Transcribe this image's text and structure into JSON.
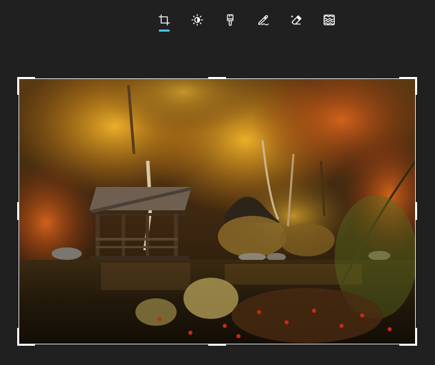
{
  "toolbar": {
    "tools": [
      {
        "name": "crop",
        "icon": "crop-icon",
        "active": true
      },
      {
        "name": "adjustment",
        "icon": "brightness-icon",
        "active": false
      },
      {
        "name": "filter",
        "icon": "filter-brush-icon",
        "active": false
      },
      {
        "name": "markup",
        "icon": "pen-icon",
        "active": false
      },
      {
        "name": "erase",
        "icon": "eraser-icon",
        "active": false
      },
      {
        "name": "background",
        "icon": "background-blur-icon",
        "active": false
      }
    ],
    "accent_color": "#4cc2ff",
    "icon_color": "#ffffff"
  },
  "canvas": {
    "image_subject": "autumn-lake-gazebo-photo",
    "crop_frame_color": "#ffffff"
  },
  "theme": {
    "background": "#202020"
  }
}
